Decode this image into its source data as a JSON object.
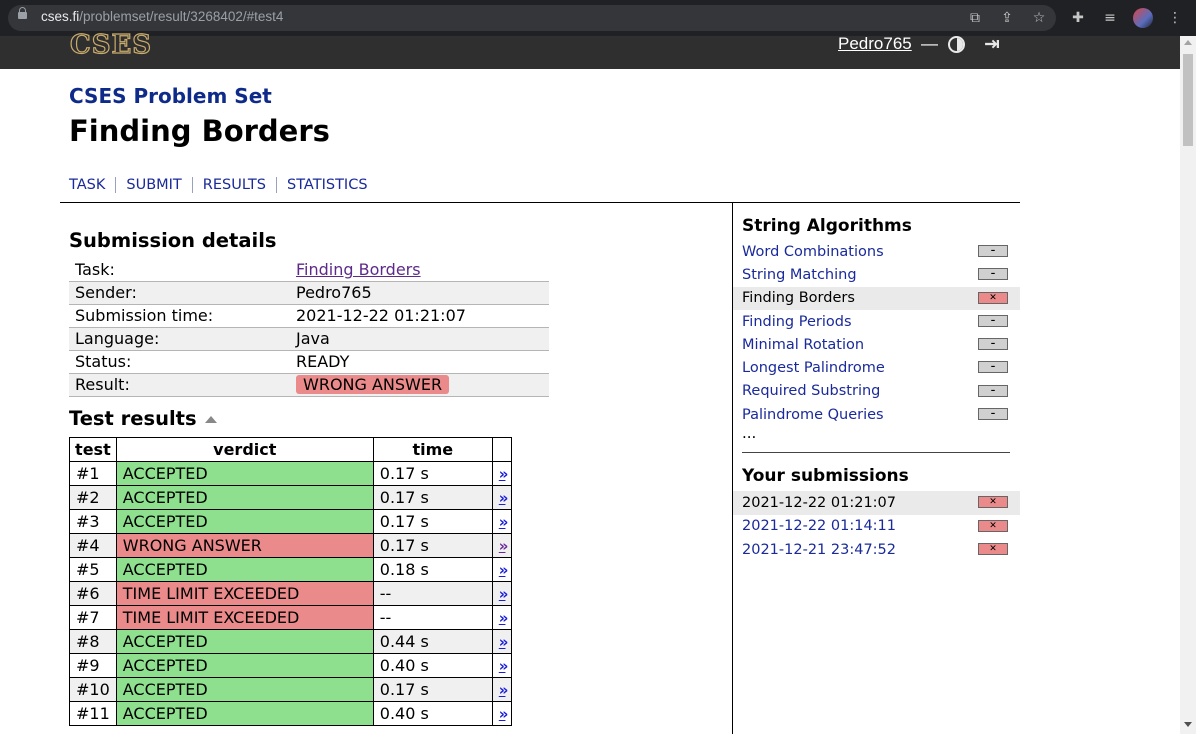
{
  "browser": {
    "url_host": "cses.fi",
    "url_path": "/problemset/result/3268402/#test4"
  },
  "header": {
    "logo": "CSES",
    "user": "Pedro765",
    "separator": "—"
  },
  "page": {
    "set_title": "CSES Problem Set",
    "title": "Finding Borders",
    "tabs": [
      "TASK",
      "SUBMIT",
      "RESULTS",
      "STATISTICS"
    ]
  },
  "details": {
    "heading": "Submission details",
    "rows": [
      {
        "key": "Task:",
        "value": "Finding Borders"
      },
      {
        "key": "Sender:",
        "value": "Pedro765"
      },
      {
        "key": "Submission time:",
        "value": "2021-12-22 01:21:07"
      },
      {
        "key": "Language:",
        "value": "Java"
      },
      {
        "key": "Status:",
        "value": "READY"
      },
      {
        "key": "Result:",
        "value": "WRONG ANSWER"
      }
    ]
  },
  "tests": {
    "heading": "Test results",
    "columns": [
      "test",
      "verdict",
      "time"
    ],
    "link_glyph": "»",
    "rows": [
      {
        "test": "#1",
        "verdict": "ACCEPTED",
        "time": "0.17 s"
      },
      {
        "test": "#2",
        "verdict": "ACCEPTED",
        "time": "0.17 s"
      },
      {
        "test": "#3",
        "verdict": "ACCEPTED",
        "time": "0.17 s"
      },
      {
        "test": "#4",
        "verdict": "WRONG ANSWER",
        "time": "0.17 s"
      },
      {
        "test": "#5",
        "verdict": "ACCEPTED",
        "time": "0.18 s"
      },
      {
        "test": "#6",
        "verdict": "TIME LIMIT EXCEEDED",
        "time": "--"
      },
      {
        "test": "#7",
        "verdict": "TIME LIMIT EXCEEDED",
        "time": "--"
      },
      {
        "test": "#8",
        "verdict": "ACCEPTED",
        "time": "0.44 s"
      },
      {
        "test": "#9",
        "verdict": "ACCEPTED",
        "time": "0.40 s"
      },
      {
        "test": "#10",
        "verdict": "ACCEPTED",
        "time": "0.17 s"
      },
      {
        "test": "#11",
        "verdict": "ACCEPTED",
        "time": "0.40 s"
      }
    ]
  },
  "sidebar": {
    "section_title": "String Algorithms",
    "tasks": [
      {
        "name": "Word Combinations",
        "status": "none"
      },
      {
        "name": "String Matching",
        "status": "none"
      },
      {
        "name": "Finding Borders",
        "status": "fail",
        "current": true
      },
      {
        "name": "Finding Periods",
        "status": "none"
      },
      {
        "name": "Minimal Rotation",
        "status": "none"
      },
      {
        "name": "Longest Palindrome",
        "status": "none"
      },
      {
        "name": "Required Substring",
        "status": "none"
      },
      {
        "name": "Palindrome Queries",
        "status": "none"
      }
    ],
    "ellipsis": "...",
    "submissions_title": "Your submissions",
    "submissions": [
      {
        "time": "2021-12-22 01:21:07",
        "status": "fail",
        "current": true
      },
      {
        "time": "2021-12-22 01:14:11",
        "status": "fail"
      },
      {
        "time": "2021-12-21 23:47:52",
        "status": "fail"
      }
    ]
  },
  "colors": {
    "accepted": "#8ee08e",
    "failed": "#ea8a8a",
    "link": "#1a2a9a",
    "header_bg": "#302f2f"
  }
}
